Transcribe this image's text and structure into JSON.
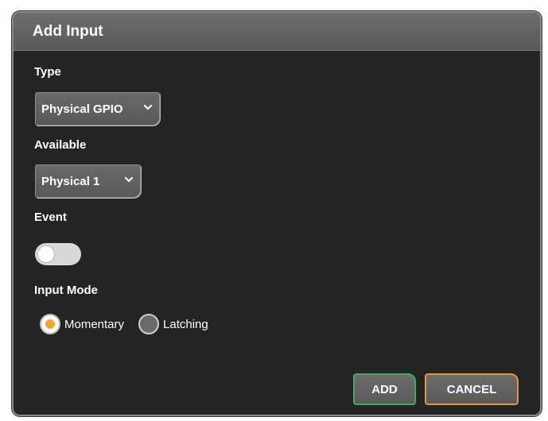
{
  "dialog": {
    "title": "Add Input",
    "type": {
      "label": "Type",
      "selected": "Physical GPIO"
    },
    "available": {
      "label": "Available",
      "selected": "Physical 1"
    },
    "event": {
      "label": "Event",
      "enabled": false
    },
    "input_mode": {
      "label": "Input Mode",
      "options": [
        {
          "label": "Momentary",
          "checked": true
        },
        {
          "label": "Latching",
          "checked": false
        }
      ]
    },
    "buttons": {
      "add_label": "ADD",
      "cancel_label": "CANCEL"
    }
  },
  "colors": {
    "background": "#242424",
    "header": "#5f5f5f",
    "radio_accent": "#f5a623",
    "add_border": "#3fae5c",
    "cancel_border": "#d89a3c"
  }
}
